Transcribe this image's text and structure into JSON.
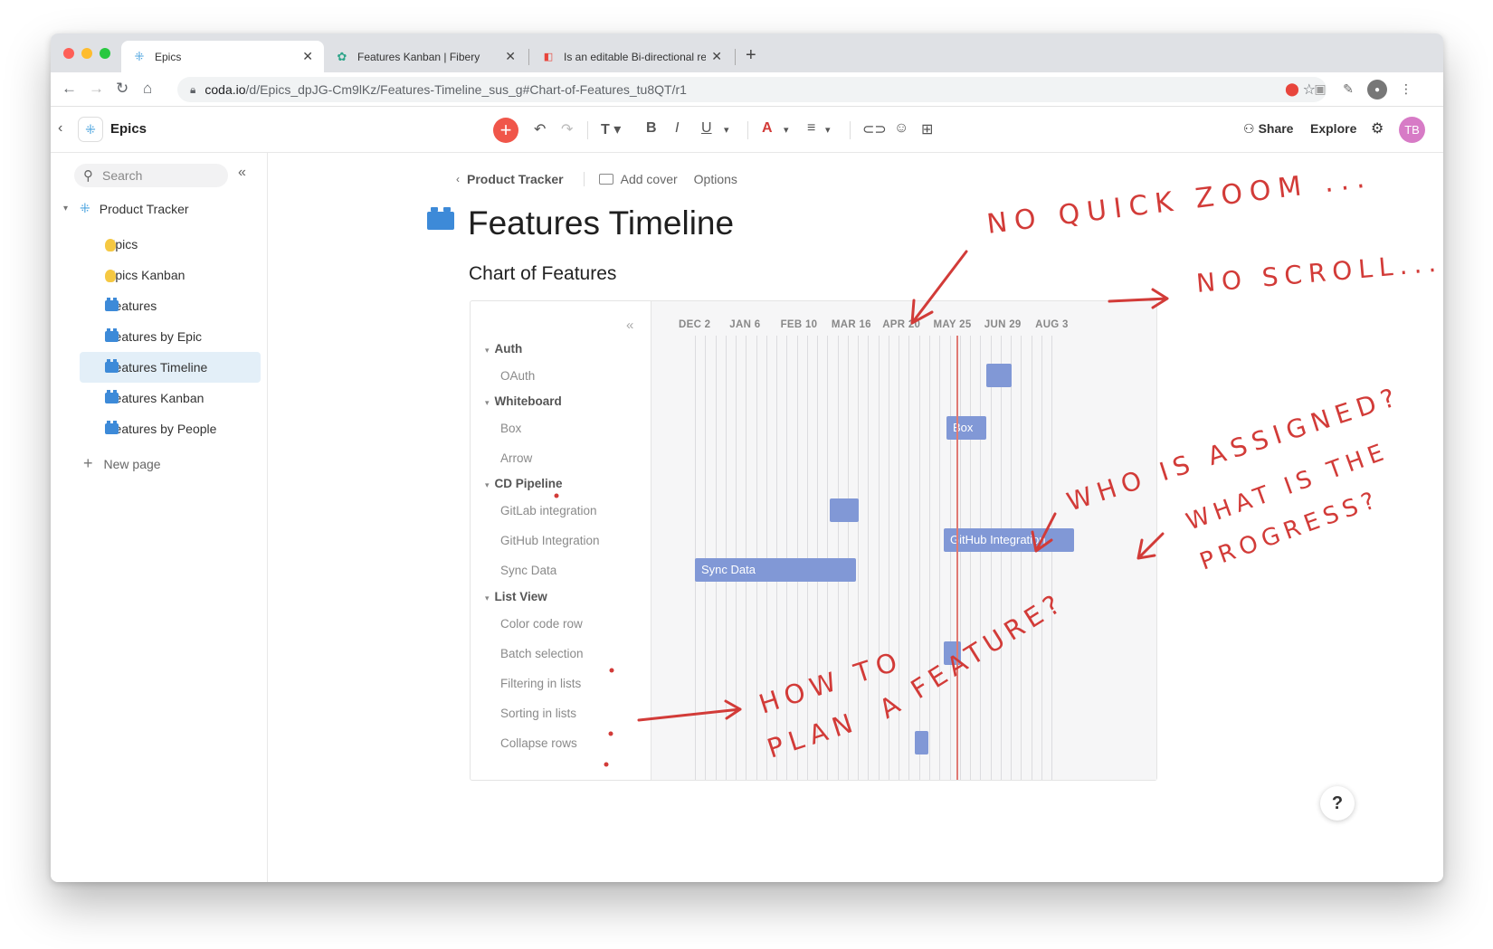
{
  "browser": {
    "tabs": [
      {
        "title": "Epics",
        "close": "✕"
      },
      {
        "title": "Features Kanban | Fibery",
        "close": "✕"
      },
      {
        "title": "Is an editable Bi-directional rel",
        "close": "✕"
      }
    ],
    "new_tab": "+",
    "url_host": "coda.io",
    "url_path": "/d/Epics_dpJG-Cm9lKz/Features-Timeline_sus_g#Chart-of-Features_tu8QT/r1"
  },
  "app": {
    "doc_title": "Epics",
    "share_label": "Share",
    "explore_label": "Explore",
    "avatar_initials": "TB",
    "accent_color": "#f0564a"
  },
  "sidebar": {
    "search_placeholder": "Search",
    "root_label": "Product Tracker",
    "items": [
      {
        "label": "Epics",
        "icon": "lightbulb-icon"
      },
      {
        "label": "Epics Kanban",
        "icon": "lightbulb-icon"
      },
      {
        "label": "Features",
        "icon": "blocks-icon"
      },
      {
        "label": "Features by Epic",
        "icon": "blocks-icon"
      },
      {
        "label": "Features Timeline",
        "icon": "blocks-icon",
        "selected": true
      },
      {
        "label": "Features Kanban",
        "icon": "blocks-icon"
      },
      {
        "label": "Features by People",
        "icon": "blocks-icon"
      }
    ],
    "new_page_label": "New page"
  },
  "page": {
    "breadcrumb": "Product Tracker",
    "add_cover": "Add cover",
    "options": "Options",
    "title": "Features Timeline",
    "section_title": "Chart of Features"
  },
  "chart_data": {
    "type": "gantt",
    "ticks": [
      "DEC 2",
      "JAN 6",
      "FEB 10",
      "MAR 16",
      "APR 20",
      "MAY 25",
      "JUN 29",
      "AUG 3"
    ],
    "today_marker": true,
    "bar_color": "#8198d6",
    "today_color": "#e07a74",
    "groups": [
      {
        "name": "Auth",
        "rows": [
          {
            "name": "OAuth",
            "bar_label": ""
          }
        ]
      },
      {
        "name": "Whiteboard",
        "rows": [
          {
            "name": "Box",
            "bar_label": "Box"
          },
          {
            "name": "Arrow",
            "bar_label": ""
          }
        ]
      },
      {
        "name": "CD Pipeline",
        "rows": [
          {
            "name": "GitLab integration",
            "bar_label": ""
          },
          {
            "name": "GitHub Integration",
            "bar_label": "GitHub Integration"
          },
          {
            "name": "Sync Data",
            "bar_label": "Sync Data"
          }
        ]
      },
      {
        "name": "List View",
        "rows": [
          {
            "name": "Color code row",
            "bar_label": ""
          },
          {
            "name": "Batch selection",
            "bar_label": ""
          },
          {
            "name": "Filtering in lists",
            "bar_label": ""
          },
          {
            "name": "Sorting in lists",
            "bar_label": ""
          },
          {
            "name": "Collapse rows",
            "bar_label": ""
          }
        ]
      }
    ]
  },
  "annotations": {
    "zoom": "NO QUICK ZOOM ...",
    "scroll": "NO SCROLL...",
    "assigned": "WHO IS ASSIGNED?",
    "progress_1": "WHAT IS THE",
    "progress_2": "PROGRESS?",
    "plan_1": "HOW TO",
    "plan_2": "PLAN",
    "plan_3": "A FEATURE?",
    "ink_color": "#d23b38"
  },
  "help_label": "?"
}
